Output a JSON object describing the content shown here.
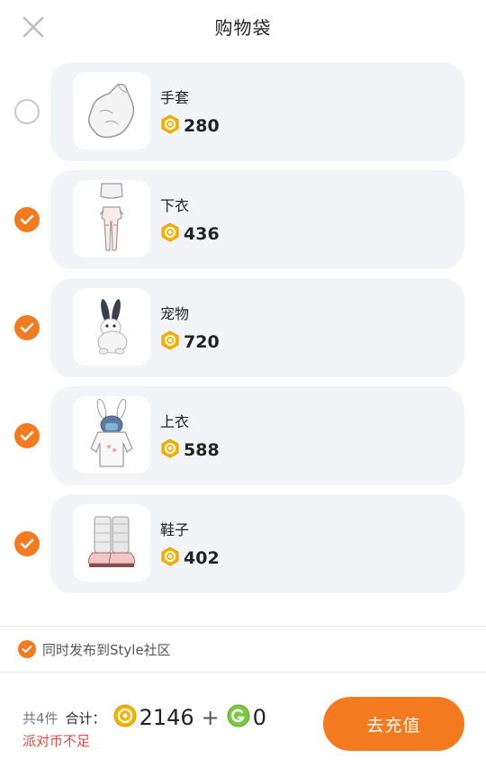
{
  "header": {
    "title": "购物袋",
    "close_icon": "close-icon"
  },
  "items": [
    {
      "name": "手套",
      "price": "280",
      "selected": false,
      "icon": "glove-icon"
    },
    {
      "name": "下衣",
      "price": "436",
      "selected": true,
      "icon": "bottoms-icon"
    },
    {
      "name": "宠物",
      "price": "720",
      "selected": true,
      "icon": "bunny-pet-icon"
    },
    {
      "name": "上衣",
      "price": "588",
      "selected": true,
      "icon": "bunny-hoodie-icon"
    },
    {
      "name": "鞋子",
      "price": "402",
      "selected": true,
      "icon": "boots-icon"
    }
  ],
  "publish": {
    "label": "同时发布到Style社区",
    "checked": true
  },
  "footer": {
    "count_text": "共4件",
    "total_label": "合计：",
    "coin_total": "2146",
    "plus": "+",
    "gem_total": "0",
    "warning": "派对币不足",
    "recharge_label": "去充值"
  },
  "colors": {
    "accent": "#f47a1f",
    "card_bg": "#f3f4f8",
    "warning": "#e8483c",
    "coin": "#f5b300",
    "gem": "#7ac943"
  }
}
